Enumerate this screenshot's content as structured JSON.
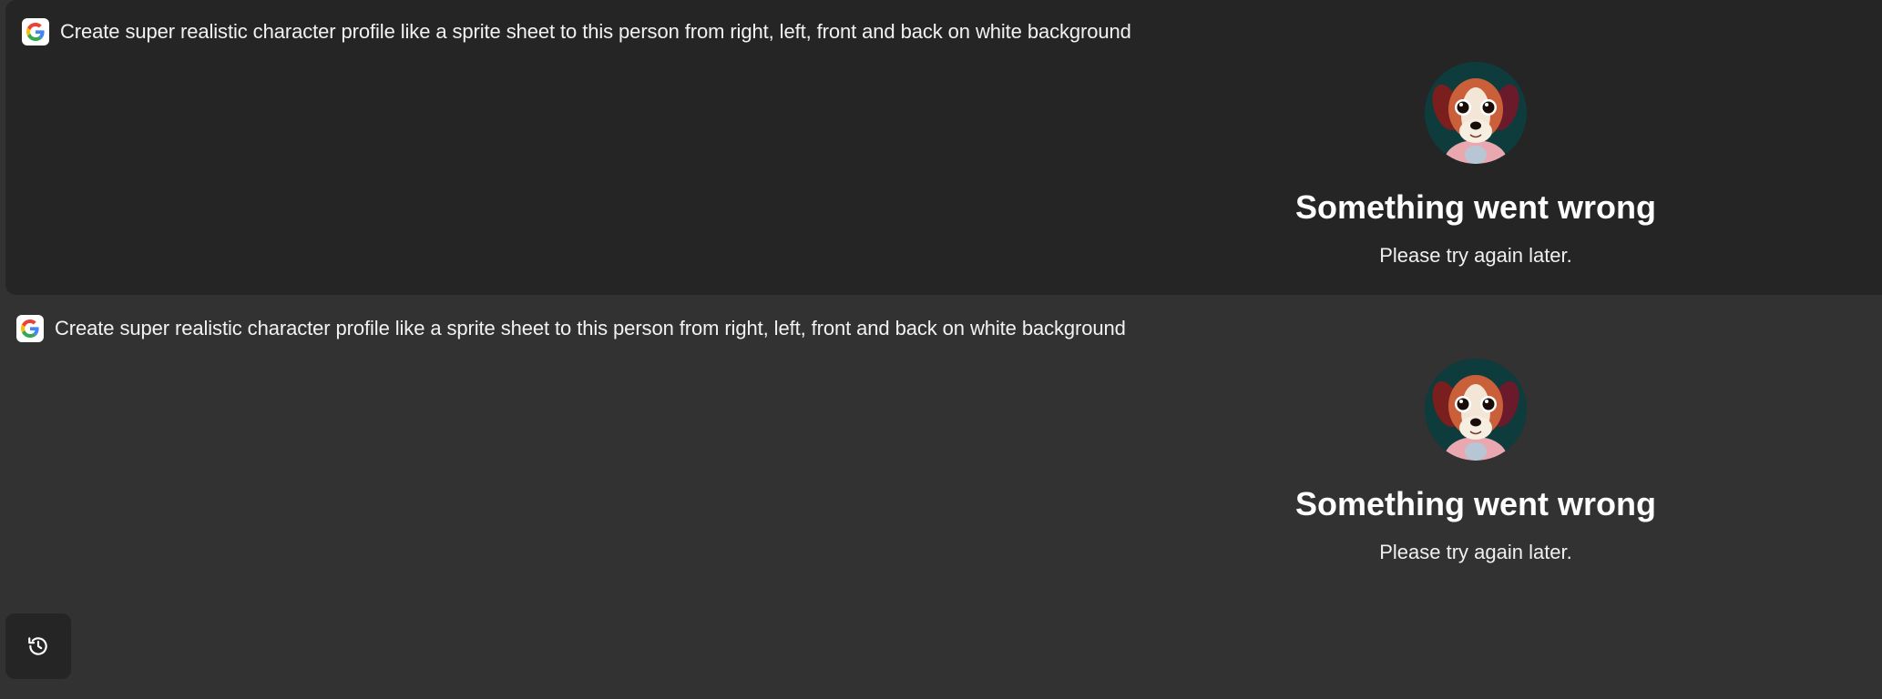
{
  "results": [
    {
      "prompt": "Create super realistic character profile like a sprite sheet to this person from right, left, front and back on white background",
      "prompt_icon": "google-icon",
      "avatar": "dog-avatar",
      "error_title": "Something went wrong",
      "error_message": "Please try again later."
    },
    {
      "prompt": "Create super realistic character profile like a sprite sheet to this person from right, left, front and back on white background",
      "prompt_icon": "google-icon",
      "avatar": "dog-avatar",
      "error_title": "Something went wrong",
      "error_message": "Please try again later."
    }
  ],
  "history_button": {
    "icon": "history-icon"
  },
  "colors": {
    "background": "#323232",
    "card_background": "#252525",
    "text": "#ffffff"
  }
}
